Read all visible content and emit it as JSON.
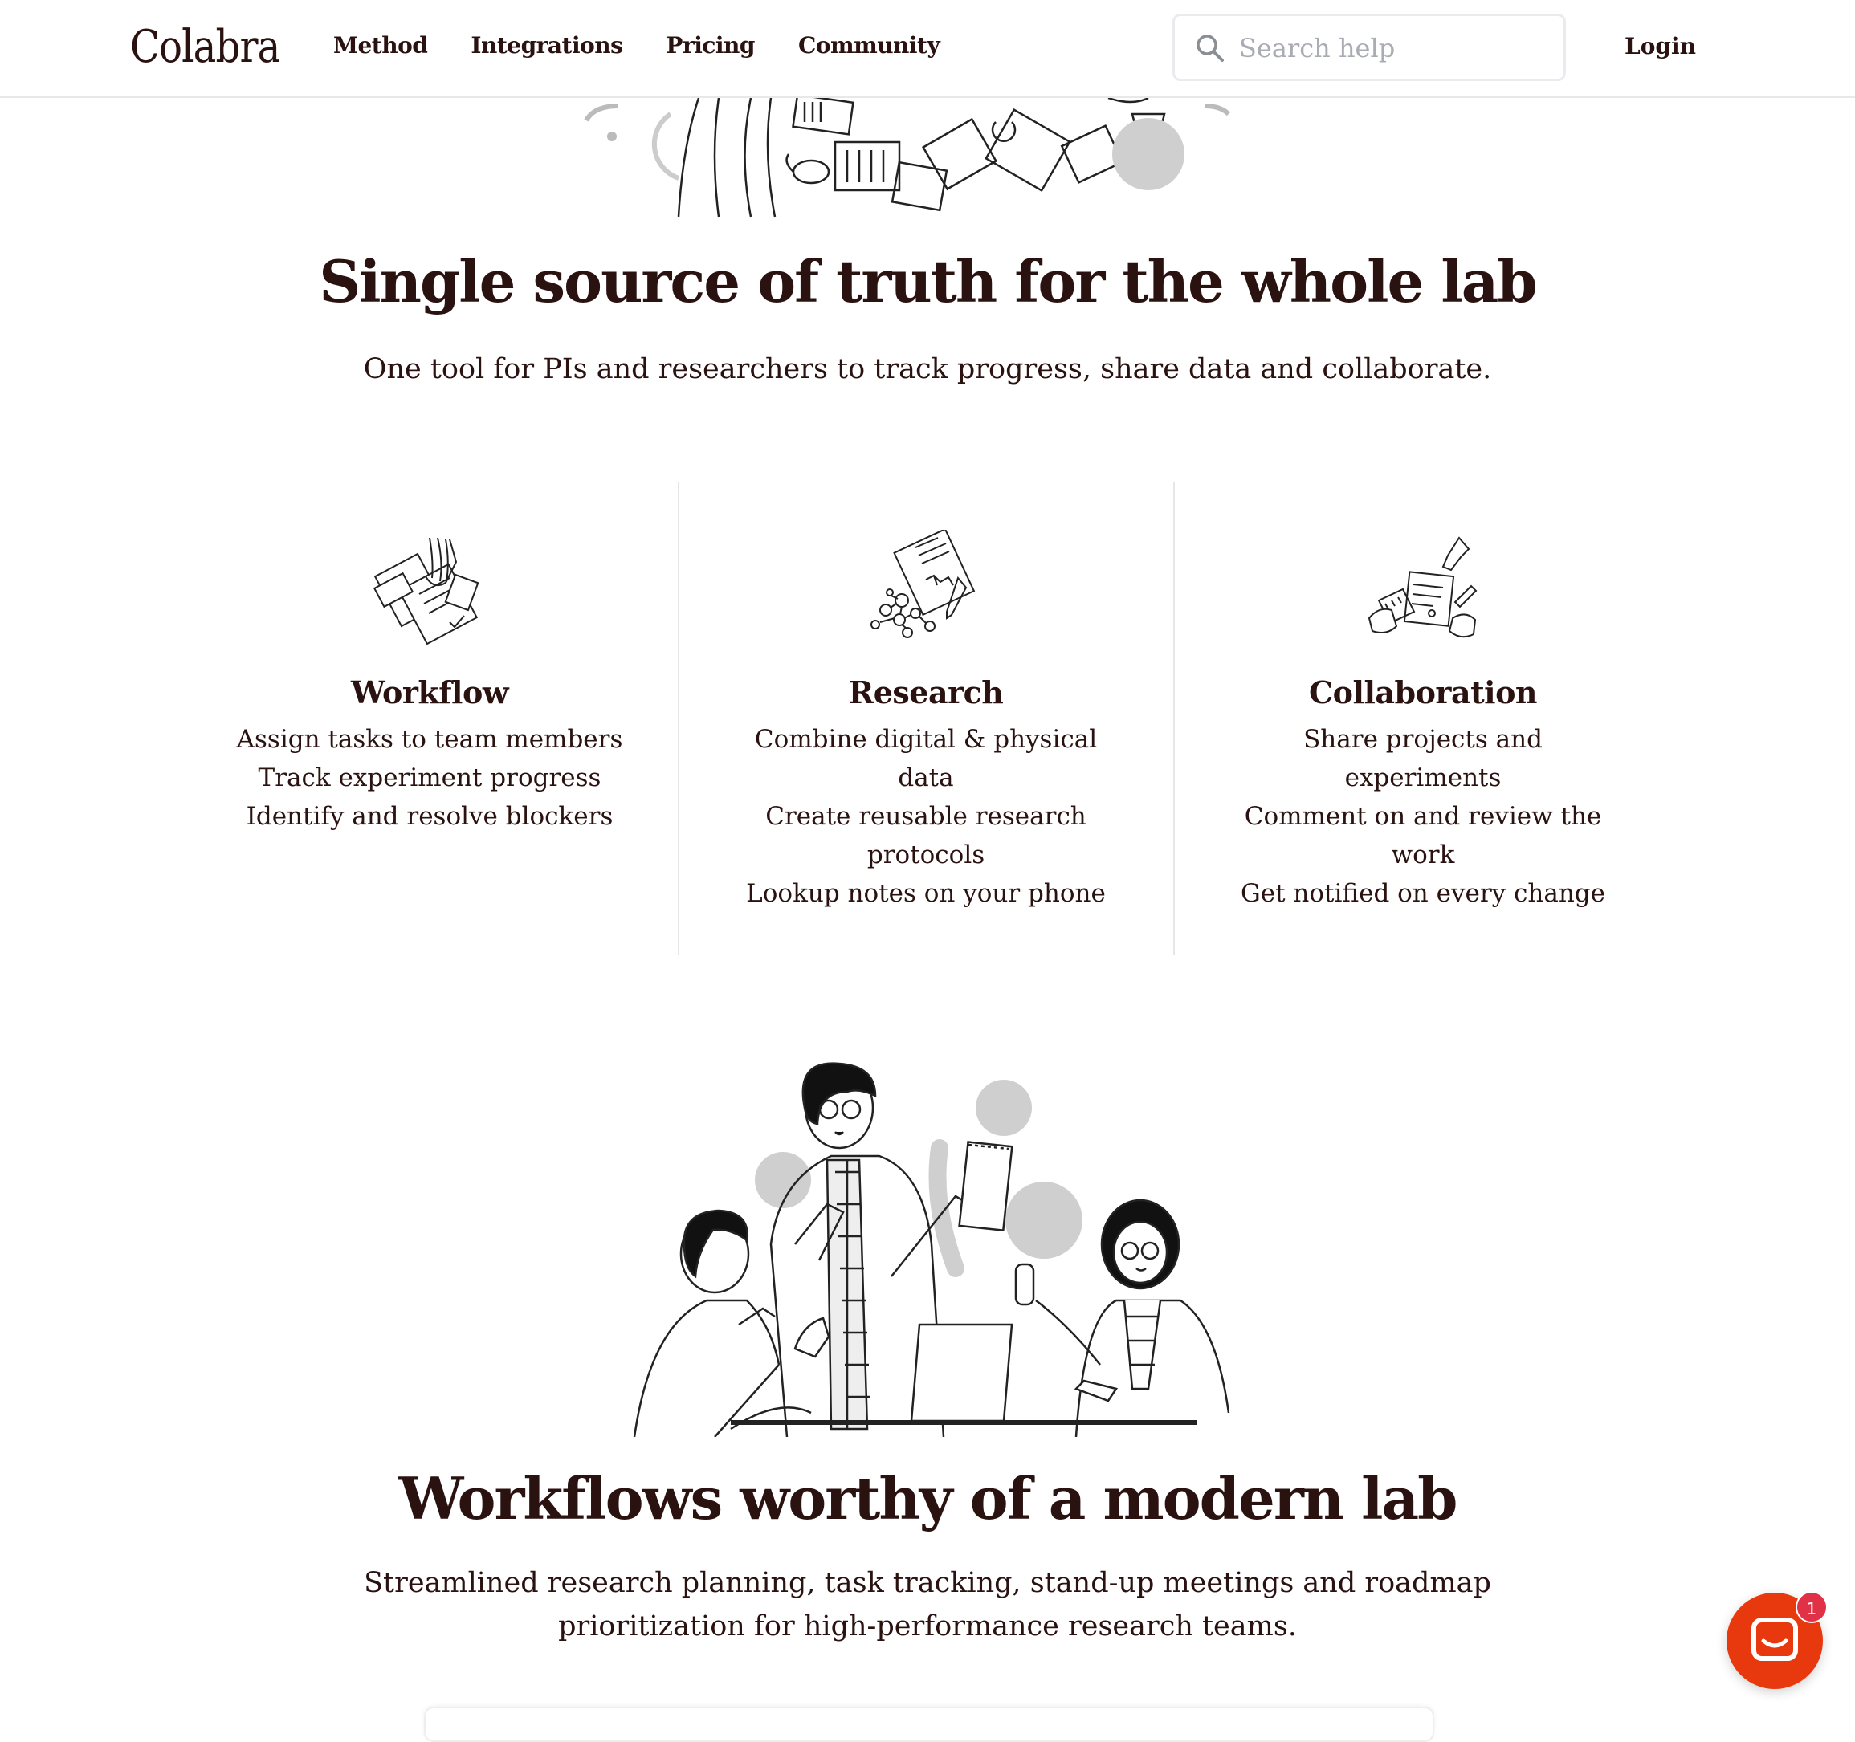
{
  "header": {
    "logo": "Colabra",
    "nav": [
      "Method",
      "Integrations",
      "Pricing",
      "Community"
    ],
    "search_placeholder": "Search help",
    "login": "Login"
  },
  "hero": {
    "title": "Single source of truth for the whole lab",
    "subtitle": "One tool for PIs and researchers to track progress, share data and collaborate."
  },
  "features": [
    {
      "icon": "workflow-illustration-icon",
      "title": "Workflow",
      "lines": [
        "Assign tasks to team members",
        "Track experiment progress",
        "Identify and resolve blockers"
      ]
    },
    {
      "icon": "research-illustration-icon",
      "title": "Research",
      "lines": [
        "Combine digital & physical data",
        "Create reusable research protocols",
        "Lookup notes on your phone"
      ]
    },
    {
      "icon": "collaboration-illustration-icon",
      "title": "Collaboration",
      "lines": [
        "Share projects and experiments",
        "Comment on and review the work",
        "Get notified on every change"
      ]
    }
  ],
  "section2": {
    "title": "Workflows worthy of a modern lab",
    "subtitle_line1": "Streamlined research planning, task tracking, stand-up meetings and roadmap",
    "subtitle_line2": "prioritization for high-performance research teams."
  },
  "chat": {
    "badge_count": "1",
    "icon": "chat-icon"
  },
  "colors": {
    "text": "#2a1210",
    "chat": "#e8380d",
    "badge": "#e03146",
    "divider": "#e6e6e6"
  }
}
